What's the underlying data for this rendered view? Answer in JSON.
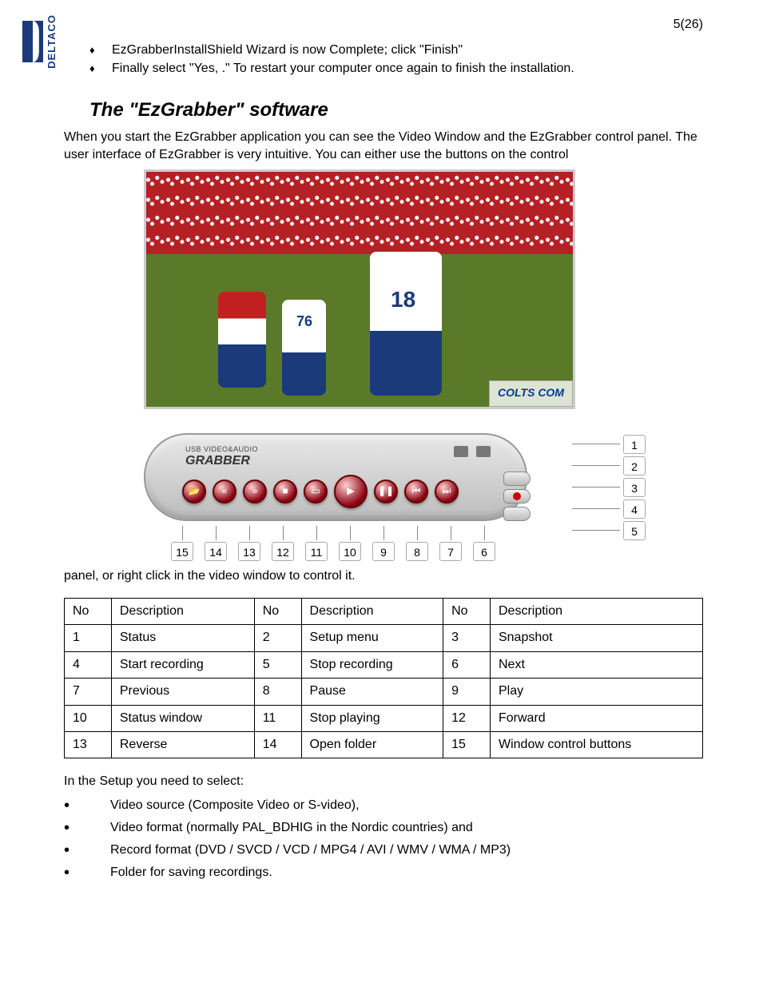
{
  "brand": {
    "name": "DELTACO"
  },
  "page_number": "5(26)",
  "install_steps": [
    "EzGrabberInstallShield Wizard is now Complete; click \"Finish\"",
    "Finally select \"Yes, .\" To restart your computer once again to finish the installation."
  ],
  "section": {
    "title": "The \"EzGrabber\" software",
    "intro": "When you start the EzGrabber application you can see the Video Window and the EzGrabber control panel. The user interface of EzGrabber is very intuitive. You can either use the buttons on the control",
    "after_figure": "panel, or right click in the video window to control it."
  },
  "figure": {
    "jersey_a": "76",
    "jersey_b": "18",
    "banner_brand": "COLTS COM",
    "panel_small": "USB VIDEO&AUDIO",
    "panel_brand": "GRABBER",
    "side_callouts": [
      "1",
      "2",
      "3",
      "4",
      "5"
    ],
    "bottom_callouts": [
      "15",
      "14",
      "13",
      "12",
      "11",
      "10",
      "9",
      "8",
      "7",
      "6"
    ]
  },
  "table": {
    "headers": [
      "No",
      "Description",
      "No",
      "Description",
      "No",
      "Description"
    ],
    "rows": [
      [
        "1",
        "Status",
        "2",
        "Setup menu",
        "3",
        "Snapshot"
      ],
      [
        "4",
        "Start recording",
        "5",
        "Stop recording",
        "6",
        "Next"
      ],
      [
        "7",
        "Previous",
        "8",
        "Pause",
        "9",
        "Play"
      ],
      [
        "10",
        "Status window",
        "11",
        "Stop playing",
        "12",
        "Forward"
      ],
      [
        "13",
        "Reverse",
        "14",
        "Open folder",
        "15",
        "Window control buttons"
      ]
    ]
  },
  "setup": {
    "intro": "In the Setup you need to select:",
    "items": [
      "Video source (Composite Video or S-video),",
      "Video format (normally PAL_BDHIG in the Nordic countries) and",
      "Record format (DVD / SVCD / VCD / MPG4 / AVI / WMV / WMA / MP3)",
      "Folder for saving recordings."
    ]
  }
}
